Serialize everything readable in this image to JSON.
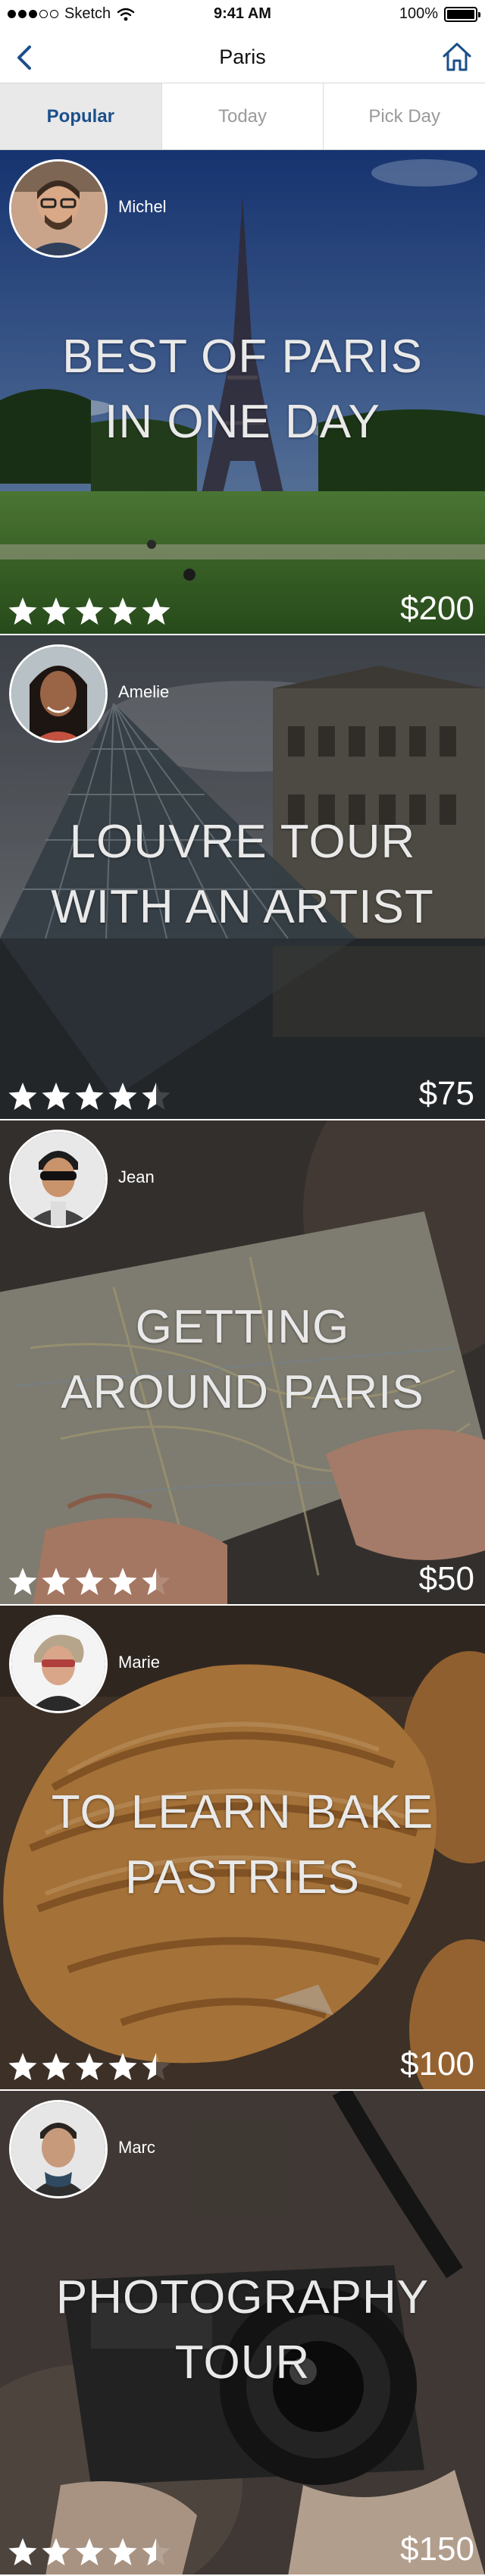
{
  "status_bar": {
    "carrier": "Sketch",
    "time": "9:41 AM",
    "battery_label": "100%",
    "battery_level": 1.0,
    "signal_dots_filled": 3,
    "signal_dots_total": 5
  },
  "nav": {
    "title": "Paris",
    "back_icon": "chevron-left-icon",
    "home_icon": "home-icon",
    "accent_color": "#1b4f8a"
  },
  "tabs": [
    {
      "label": "Popular",
      "active": true
    },
    {
      "label": "Today",
      "active": false
    },
    {
      "label": "Pick Day",
      "active": false
    }
  ],
  "tours": [
    {
      "host": "Michel",
      "title_lines": [
        "BEST OF PARIS",
        "IN ONE DAY"
      ],
      "rating": 5,
      "rating_max": 5,
      "price": "$200"
    },
    {
      "host": "Amelie",
      "title_lines": [
        "LOUVRE TOUR",
        "WITH AN ARTIST"
      ],
      "rating": 4.5,
      "rating_max": 5,
      "price": "$75"
    },
    {
      "host": "Jean",
      "title_lines": [
        "GETTING",
        "AROUND PARIS"
      ],
      "rating": 4.5,
      "rating_max": 5,
      "price": "$50"
    },
    {
      "host": "Marie",
      "title_lines": [
        "TO LEARN BAKE",
        "PASTRIES"
      ],
      "rating": 4.5,
      "rating_max": 5,
      "price": "$100"
    },
    {
      "host": "Marc",
      "title_lines": [
        "PHOTOGRAPHY",
        "TOUR"
      ],
      "rating": 4.5,
      "rating_max": 5,
      "price": "$150"
    }
  ]
}
